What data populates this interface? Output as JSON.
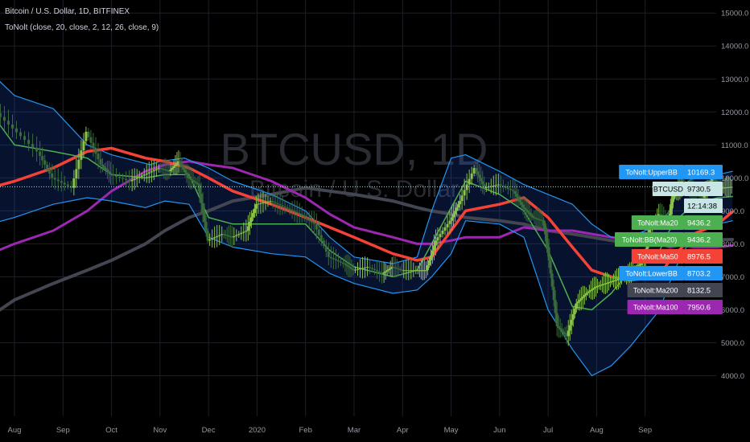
{
  "header": {
    "symbol_line": "Bitcoin / U.S. Dollar, 1D, BITFINEX",
    "indicator_line": "ToNolt (close, 20, close, 2, 12, 26, close, 9)"
  },
  "watermark": {
    "ticker": "BTCUSD, 1D",
    "name": "Bitcoin / U.S. Dollar"
  },
  "chart_data": {
    "type": "line",
    "title": "Bitcoin / U.S. Dollar, 1D, BITFINEX",
    "y_ticks": [
      4000,
      5000,
      6000,
      7000,
      8000,
      9000,
      10000,
      11000,
      12000,
      13000,
      14000,
      15000
    ],
    "y_tick_labels": [
      "4000.0",
      "5000.0",
      "6000.0",
      "7000.0",
      "8000.0",
      "9000.0",
      "10000.0",
      "11000.0",
      "12000.0",
      "13000.0",
      "14000.0",
      "15000.0"
    ],
    "ylim": [
      3550,
      15200
    ],
    "x_labels": [
      "Aug",
      "Sep",
      "Oct",
      "Nov",
      "Dec",
      "2020",
      "Feb",
      "Mar",
      "Apr",
      "May",
      "Jun",
      "Jul",
      "Aug",
      "Sep"
    ],
    "xlim": [
      0,
      14.1
    ],
    "grid": true,
    "last_price": 9730.5,
    "series": [
      {
        "name": "ToNolt:UpperBB",
        "color": "#2196f3",
        "role": "upper",
        "points": [
          [
            -0.5,
            13200
          ],
          [
            0,
            12500
          ],
          [
            0.8,
            12100
          ],
          [
            1.5,
            11000
          ],
          [
            2,
            10700
          ],
          [
            2.8,
            10400
          ],
          [
            3,
            10500
          ],
          [
            3.5,
            10600
          ],
          [
            4,
            10300
          ],
          [
            4.5,
            9900
          ],
          [
            5.3,
            9500
          ],
          [
            6,
            9000
          ],
          [
            6.5,
            8200
          ],
          [
            7,
            7600
          ],
          [
            7.8,
            7400
          ],
          [
            8.3,
            7600
          ],
          [
            8.6,
            9000
          ],
          [
            9,
            10600
          ],
          [
            9.3,
            10700
          ],
          [
            10,
            10200
          ],
          [
            10.5,
            9800
          ],
          [
            11,
            9500
          ],
          [
            11.5,
            9200
          ],
          [
            11.9,
            8600
          ],
          [
            12.3,
            8200
          ],
          [
            12.7,
            8200
          ],
          [
            13.3,
            8600
          ],
          [
            13.5,
            9000
          ],
          [
            13.7,
            9700
          ],
          [
            14,
            10000
          ],
          [
            14.5,
            10100
          ],
          [
            14.8,
            10200
          ]
        ]
      },
      {
        "name": "ToNolt:LowerBB",
        "color": "#2196f3",
        "role": "lower",
        "points": [
          [
            -0.5,
            8600
          ],
          [
            0,
            8800
          ],
          [
            0.8,
            9200
          ],
          [
            1.5,
            9400
          ],
          [
            2,
            9300
          ],
          [
            2.7,
            9100
          ],
          [
            3.1,
            9300
          ],
          [
            3.6,
            9200
          ],
          [
            4,
            8200
          ],
          [
            4.5,
            7900
          ],
          [
            5.3,
            7700
          ],
          [
            6,
            7600
          ],
          [
            6.5,
            7100
          ],
          [
            7,
            6800
          ],
          [
            7.8,
            6500
          ],
          [
            8.3,
            6600
          ],
          [
            8.6,
            7000
          ],
          [
            9,
            7700
          ],
          [
            9.3,
            8700
          ],
          [
            10,
            8600
          ],
          [
            10.5,
            8200
          ],
          [
            11,
            6000
          ],
          [
            11.5,
            4800
          ],
          [
            11.9,
            4000
          ],
          [
            12.3,
            4300
          ],
          [
            12.7,
            4900
          ],
          [
            13.3,
            6000
          ],
          [
            13.5,
            6800
          ],
          [
            13.7,
            7500
          ],
          [
            14,
            8300
          ],
          [
            14.5,
            8600
          ],
          [
            14.8,
            8700
          ]
        ]
      },
      {
        "name": "ToNolt:Ma20",
        "color": "#4caf50",
        "points": [
          [
            -0.5,
            12000
          ],
          [
            0,
            11000
          ],
          [
            0.8,
            10800
          ],
          [
            1.5,
            10600
          ],
          [
            2,
            10100
          ],
          [
            2.7,
            10000
          ],
          [
            3.1,
            10100
          ],
          [
            3.6,
            10100
          ],
          [
            4,
            8800
          ],
          [
            4.5,
            8600
          ],
          [
            5.3,
            8600
          ],
          [
            6,
            8600
          ],
          [
            6.5,
            7800
          ],
          [
            7,
            7300
          ],
          [
            7.8,
            7000
          ],
          [
            8.3,
            7200
          ],
          [
            8.6,
            8000
          ],
          [
            9,
            9100
          ],
          [
            9.3,
            9900
          ],
          [
            10,
            9500
          ],
          [
            10.5,
            9000
          ],
          [
            11,
            7800
          ],
          [
            11.5,
            6100
          ],
          [
            11.9,
            6000
          ],
          [
            12.3,
            6500
          ],
          [
            12.7,
            7200
          ],
          [
            13.3,
            7800
          ],
          [
            13.5,
            8400
          ],
          [
            13.7,
            8800
          ],
          [
            14,
            9200
          ],
          [
            14.5,
            9400
          ],
          [
            14.8,
            9436
          ]
        ]
      },
      {
        "name": "ToNolt:Ma50",
        "color": "#f44336",
        "points": [
          [
            -0.5,
            9700
          ],
          [
            0,
            9900
          ],
          [
            0.8,
            10300
          ],
          [
            1.5,
            10800
          ],
          [
            2,
            10900
          ],
          [
            2.7,
            10600
          ],
          [
            3.1,
            10500
          ],
          [
            3.6,
            10300
          ],
          [
            4,
            10000
          ],
          [
            4.5,
            9600
          ],
          [
            5.3,
            9200
          ],
          [
            6,
            8800
          ],
          [
            6.5,
            8500
          ],
          [
            7,
            8200
          ],
          [
            7.8,
            7700
          ],
          [
            8.3,
            7500
          ],
          [
            8.6,
            7600
          ],
          [
            9,
            8400
          ],
          [
            9.3,
            9000
          ],
          [
            10,
            9200
          ],
          [
            10.5,
            9400
          ],
          [
            11,
            8800
          ],
          [
            11.5,
            7900
          ],
          [
            11.9,
            7200
          ],
          [
            12.3,
            7000
          ],
          [
            12.7,
            6900
          ],
          [
            13.3,
            7000
          ],
          [
            13.5,
            7500
          ],
          [
            13.7,
            7800
          ],
          [
            14,
            8300
          ],
          [
            14.5,
            8600
          ],
          [
            14.8,
            8976
          ]
        ]
      },
      {
        "name": "ToNolt:Ma100",
        "color": "#9c27b0",
        "points": [
          [
            -0.5,
            7700
          ],
          [
            0,
            8000
          ],
          [
            0.8,
            8400
          ],
          [
            1.5,
            9000
          ],
          [
            2,
            9600
          ],
          [
            2.7,
            10200
          ],
          [
            3.1,
            10400
          ],
          [
            3.6,
            10500
          ],
          [
            4,
            10400
          ],
          [
            4.5,
            10300
          ],
          [
            5.3,
            9900
          ],
          [
            6,
            9400
          ],
          [
            6.5,
            8900
          ],
          [
            7,
            8500
          ],
          [
            7.8,
            8200
          ],
          [
            8.3,
            8000
          ],
          [
            8.6,
            8000
          ],
          [
            9,
            8100
          ],
          [
            9.3,
            8200
          ],
          [
            10,
            8200
          ],
          [
            10.5,
            8500
          ],
          [
            11,
            8400
          ],
          [
            11.5,
            8400
          ],
          [
            11.9,
            8300
          ],
          [
            12.3,
            8200
          ],
          [
            12.7,
            8100
          ],
          [
            13.3,
            8000
          ],
          [
            13.5,
            7900
          ],
          [
            13.7,
            7950
          ],
          [
            14,
            7900
          ],
          [
            14.5,
            7900
          ],
          [
            14.8,
            7950
          ]
        ]
      },
      {
        "name": "ToNolt:Ma200",
        "color": "#434651",
        "points": [
          [
            -0.5,
            5800
          ],
          [
            0,
            6300
          ],
          [
            0.8,
            6800
          ],
          [
            1.5,
            7200
          ],
          [
            2,
            7500
          ],
          [
            2.7,
            8000
          ],
          [
            3.1,
            8400
          ],
          [
            3.6,
            8800
          ],
          [
            4,
            9000
          ],
          [
            4.5,
            9300
          ],
          [
            5.3,
            9500
          ],
          [
            6,
            9700
          ],
          [
            6.5,
            9600
          ],
          [
            7,
            9500
          ],
          [
            7.8,
            9300
          ],
          [
            8.3,
            9100
          ],
          [
            8.6,
            9000
          ],
          [
            9,
            8900
          ],
          [
            9.3,
            8800
          ],
          [
            10,
            8700
          ],
          [
            10.5,
            8600
          ],
          [
            11,
            8400
          ],
          [
            11.5,
            8300
          ],
          [
            11.9,
            8200
          ],
          [
            12.3,
            8100
          ],
          [
            12.7,
            8000
          ],
          [
            13.3,
            8000
          ],
          [
            13.5,
            8000
          ],
          [
            13.7,
            8050
          ],
          [
            14,
            8100
          ],
          [
            14.5,
            8120
          ],
          [
            14.8,
            8132
          ]
        ]
      },
      {
        "name": "ToNolt:BB(Ma20)",
        "color": "#4caf50",
        "overlaps": "ToNolt:Ma20",
        "points": []
      },
      {
        "name": "Price",
        "color": "#8bc34a",
        "role": "price",
        "points": [
          [
            -0.5,
            12200
          ],
          [
            0,
            11500
          ],
          [
            0.5,
            10800
          ],
          [
            0.8,
            10000
          ],
          [
            1.2,
            9700
          ],
          [
            1.5,
            11400
          ],
          [
            1.8,
            10400
          ],
          [
            2,
            10100
          ],
          [
            2.4,
            9900
          ],
          [
            2.7,
            10100
          ],
          [
            3,
            10300
          ],
          [
            3.2,
            10200
          ],
          [
            3.4,
            10500
          ],
          [
            3.6,
            10000
          ],
          [
            3.8,
            9800
          ],
          [
            4,
            8100
          ],
          [
            4.3,
            8300
          ],
          [
            4.5,
            8200
          ],
          [
            4.8,
            8400
          ],
          [
            5,
            9200
          ],
          [
            5.3,
            9300
          ],
          [
            5.6,
            9100
          ],
          [
            5.9,
            8900
          ],
          [
            6.2,
            8600
          ],
          [
            6.5,
            7600
          ],
          [
            6.8,
            7400
          ],
          [
            7,
            7200
          ],
          [
            7.3,
            7300
          ],
          [
            7.6,
            7100
          ],
          [
            7.8,
            7300
          ],
          [
            8,
            7200
          ],
          [
            8.3,
            7200
          ],
          [
            8.5,
            7200
          ],
          [
            8.7,
            8100
          ],
          [
            9,
            8700
          ],
          [
            9.2,
            9300
          ],
          [
            9.5,
            10300
          ],
          [
            9.7,
            9700
          ],
          [
            10,
            9800
          ],
          [
            10.3,
            9600
          ],
          [
            10.5,
            9100
          ],
          [
            10.7,
            8800
          ],
          [
            10.9,
            8700
          ],
          [
            11,
            7900
          ],
          [
            11.2,
            5500
          ],
          [
            11.4,
            5200
          ],
          [
            11.6,
            6200
          ],
          [
            11.8,
            6500
          ],
          [
            12,
            6700
          ],
          [
            12.2,
            6800
          ],
          [
            12.4,
            6900
          ],
          [
            12.6,
            7000
          ],
          [
            12.8,
            7200
          ],
          [
            13,
            7500
          ],
          [
            13.1,
            8500
          ],
          [
            13.3,
            8900
          ],
          [
            13.5,
            8800
          ],
          [
            13.6,
            9500
          ],
          [
            13.8,
            9800
          ],
          [
            14,
            9600
          ],
          [
            14.2,
            9400
          ],
          [
            14.4,
            10000
          ],
          [
            14.6,
            9700
          ],
          [
            14.8,
            9730
          ]
        ]
      }
    ]
  },
  "price_tags": [
    {
      "name": "ToNolt:UpperBB",
      "value": "10169.3",
      "color": "#2196f3",
      "text_color": "#ffffff"
    },
    {
      "name": "BTCUSD",
      "value": "9730.5",
      "color": "#c8e6e6",
      "text_color": "#000000"
    },
    {
      "name": "",
      "value": "12:14:38",
      "color": "#c8e6e6",
      "text_color": "#000000"
    },
    {
      "name": "ToNolt:Ma20",
      "value": "9436.2",
      "color": "#4caf50",
      "text_color": "#ffffff"
    },
    {
      "name": "ToNolt:BB(Ma20)",
      "value": "9436.2",
      "color": "#4caf50",
      "text_color": "#ffffff"
    },
    {
      "name": "ToNolt:Ma50",
      "value": "8976.5",
      "color": "#f44336",
      "text_color": "#ffffff"
    },
    {
      "name": "ToNolt:LowerBB",
      "value": "8703.2",
      "color": "#2196f3",
      "text_color": "#ffffff"
    },
    {
      "name": "ToNolt:Ma200",
      "value": "8132.5",
      "color": "#434651",
      "text_color": "#ffffff"
    },
    {
      "name": "ToNolt:Ma100",
      "value": "7950.6",
      "color": "#9c27b0",
      "text_color": "#ffffff"
    }
  ],
  "colors": {
    "background": "#000000",
    "grid": "#1c1f26",
    "band_fill": "#2962ff",
    "axis_text": "#9598a1"
  }
}
